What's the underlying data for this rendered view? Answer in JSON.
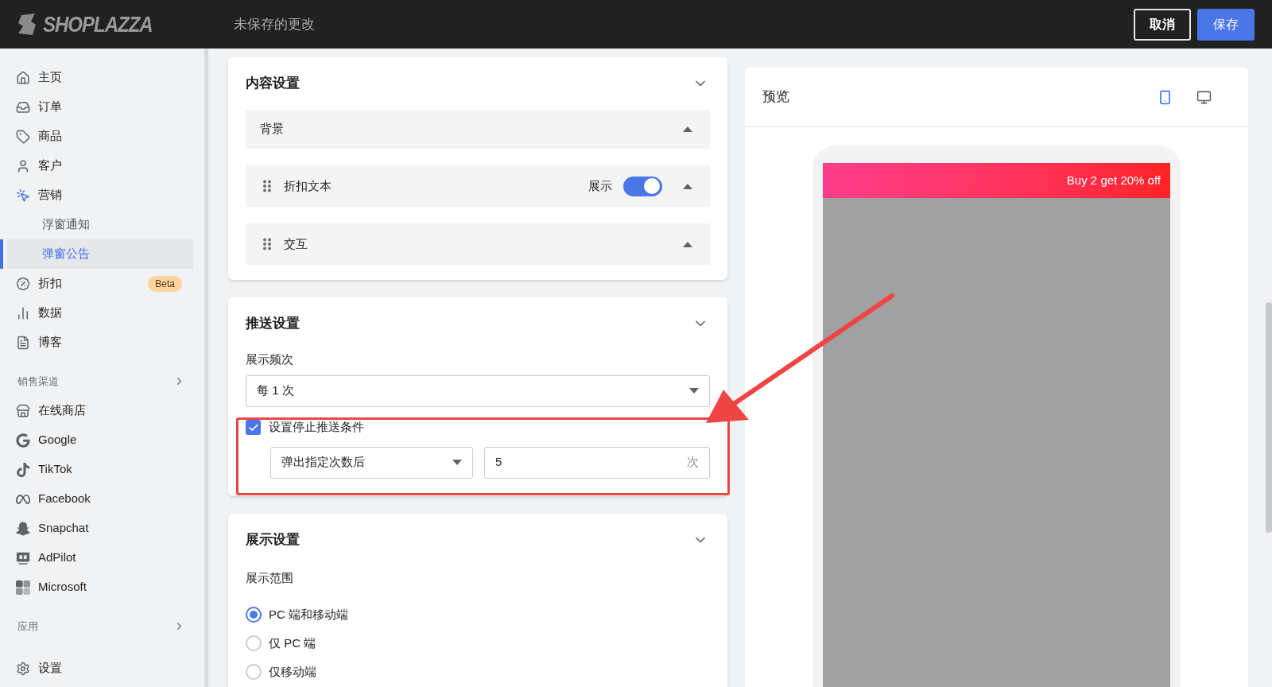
{
  "header": {
    "logo": "SHOPLAZZA",
    "title": "未保存的更改",
    "buttons": [
      {
        "label": "取消",
        "kind": "secondary"
      },
      {
        "label": "保存",
        "kind": "primary"
      }
    ]
  },
  "sidebar": {
    "items": [
      {
        "kind": "item",
        "label": "主页",
        "selected": false
      },
      {
        "kind": "item",
        "label": "订单",
        "selected": false
      },
      {
        "kind": "item",
        "label": "商品",
        "selected": false
      },
      {
        "kind": "item",
        "label": "客户",
        "selected": false
      },
      {
        "kind": "item",
        "label": "营销",
        "selected": true
      },
      {
        "kind": "subitem",
        "label": "浮窗通知",
        "selected": false
      },
      {
        "kind": "subitem",
        "label": "弹窗公告",
        "selected": true
      },
      {
        "kind": "item",
        "label": "折扣",
        "selected": false,
        "badge": "Beta"
      },
      {
        "kind": "item",
        "label": "数据",
        "selected": false
      },
      {
        "kind": "item",
        "label": "博客",
        "selected": false
      },
      {
        "kind": "section",
        "label": "销售渠道"
      },
      {
        "kind": "item",
        "label": "在线商店",
        "selected": false
      },
      {
        "kind": "item",
        "label": "Google",
        "selected": false
      },
      {
        "kind": "item",
        "label": "TikTok",
        "selected": false
      },
      {
        "kind": "item",
        "label": "Facebook",
        "selected": false
      },
      {
        "kind": "item",
        "label": "Snapchat",
        "selected": false
      },
      {
        "kind": "item",
        "label": "AdPilot",
        "selected": false
      },
      {
        "kind": "item",
        "label": "Microsoft",
        "selected": false
      },
      {
        "kind": "section",
        "label": "应用"
      },
      {
        "kind": "item",
        "label": "设置",
        "selected": false
      }
    ]
  },
  "content_settings": {
    "title": "内容设置",
    "panels": [
      {
        "label": "背景",
        "draggable": false
      },
      {
        "label": "折扣文本",
        "draggable": true,
        "toggle": {
          "label": "展示",
          "on": true
        }
      },
      {
        "label": "交互",
        "draggable": true
      }
    ]
  },
  "push_settings": {
    "title": "推送设置",
    "frequency_label": "展示频次",
    "frequency": "每 1 次",
    "stop_condition": {
      "label": "设置停止推送条件",
      "checked": true,
      "condition": "弹出指定次数后",
      "count": "5",
      "unit": "次"
    }
  },
  "display_settings": {
    "title": "展示设置",
    "scope_label": "展示范围",
    "options": [
      {
        "label": "PC 端和移动端",
        "selected": true
      },
      {
        "label": "仅 PC 端",
        "selected": false
      },
      {
        "label": "仅移动端",
        "selected": false
      }
    ]
  },
  "preview": {
    "title": "预览",
    "devices": [
      {
        "kind": "mobile",
        "selected": true
      },
      {
        "kind": "desktop",
        "selected": false
      }
    ],
    "banner": "Buy 2 get 20% off"
  }
}
